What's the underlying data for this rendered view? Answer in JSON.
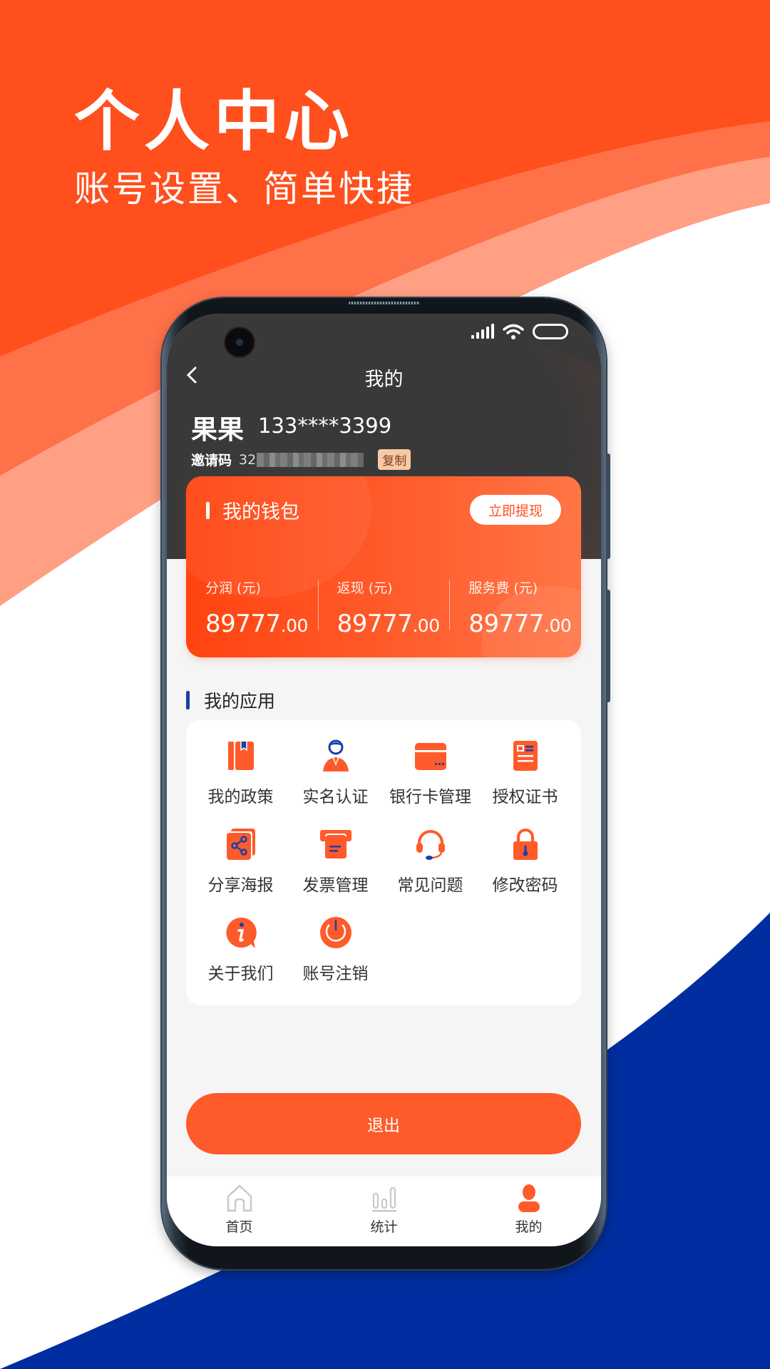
{
  "promo": {
    "title": "个人中心",
    "subtitle": "账号设置、简单快捷"
  },
  "colors": {
    "brand_orange": "#ff5a2a",
    "header_dark": "#3a3939",
    "accent_blue": "#1b3fa6",
    "bg_blue": "#002ea0",
    "copy_badge_bg": "#f8c9a5"
  },
  "status_bar": {
    "icons": [
      "signal-icon",
      "wifi-icon",
      "battery-icon"
    ]
  },
  "nav": {
    "back_icon": "chevron-left-icon",
    "title": "我的"
  },
  "user": {
    "name": "果果",
    "phone": "133****3399",
    "invite_label": "邀请码",
    "invite_code_visible": "32",
    "copy_label": "复制"
  },
  "wallet": {
    "title": "我的钱包",
    "withdraw_label": "立即提现",
    "stats": [
      {
        "label": "分润 (元)",
        "integer": "89777",
        "decimal": ".00"
      },
      {
        "label": "返现 (元)",
        "integer": "89777",
        "decimal": ".00"
      },
      {
        "label": "服务费 (元)",
        "integer": "89777",
        "decimal": ".00"
      }
    ]
  },
  "apps": {
    "title": "我的应用",
    "items": [
      {
        "label": "我的政策",
        "icon": "book-icon"
      },
      {
        "label": "实名认证",
        "icon": "person-id-icon"
      },
      {
        "label": "银行卡管理",
        "icon": "bank-card-icon"
      },
      {
        "label": "授权证书",
        "icon": "certificate-icon"
      },
      {
        "label": "分享海报",
        "icon": "share-icon"
      },
      {
        "label": "发票管理",
        "icon": "invoice-icon"
      },
      {
        "label": "常见问题",
        "icon": "headset-icon"
      },
      {
        "label": "修改密码",
        "icon": "lock-icon"
      },
      {
        "label": "关于我们",
        "icon": "info-icon"
      },
      {
        "label": "账号注销",
        "icon": "power-icon"
      }
    ]
  },
  "logout_label": "退出",
  "tabs": [
    {
      "label": "首页",
      "icon": "home-icon",
      "active": false
    },
    {
      "label": "统计",
      "icon": "chart-icon",
      "active": false
    },
    {
      "label": "我的",
      "icon": "user-icon",
      "active": true
    }
  ]
}
